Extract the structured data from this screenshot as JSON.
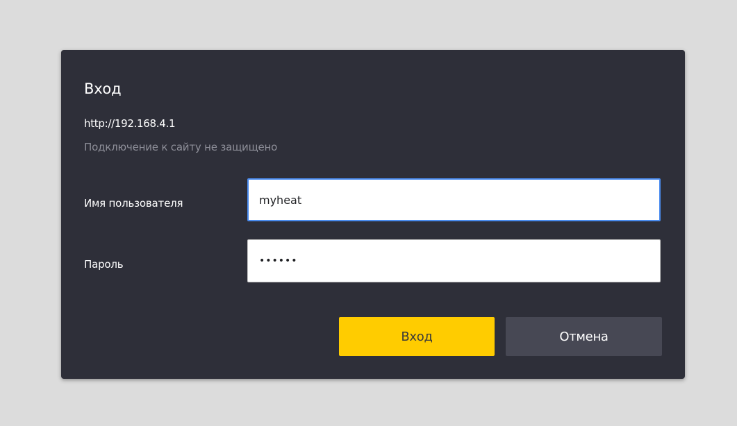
{
  "colors": {
    "backdrop": "#dcdcdc",
    "dialog_bg": "#2e2f39",
    "title_text": "#ffffff",
    "url_text": "#ffffff",
    "muted_text": "#8e8f99",
    "label_text": "#ffffff",
    "input_bg": "#ffffff",
    "focus_border": "#4a8cf0",
    "login_bg": "#ffcc00",
    "login_text": "#3a3a3a",
    "cancel_bg": "#474854",
    "cancel_text": "#ffffff"
  },
  "dialog": {
    "title": "Вход",
    "url": "http://192.168.4.1",
    "security_note": "Подключение к сайту не защищено",
    "username": {
      "label": "Имя пользователя",
      "value": "myheat"
    },
    "password": {
      "label": "Пароль",
      "value": "••••••"
    },
    "buttons": {
      "login_label": "Вход",
      "cancel_label": "Отмена"
    }
  }
}
